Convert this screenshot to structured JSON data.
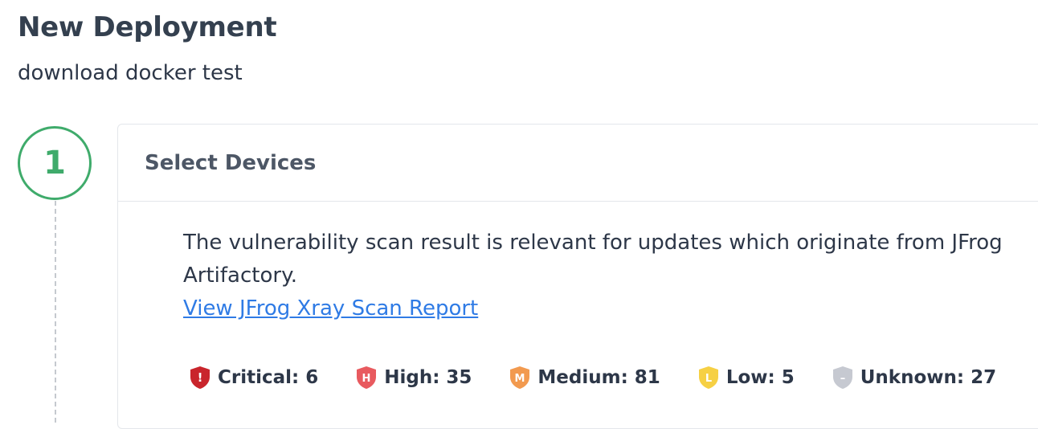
{
  "header": {
    "title": "New Deployment",
    "subtitle": "download docker test"
  },
  "step": {
    "number": "1",
    "color": "#3fab6b",
    "title": "Select Devices"
  },
  "scan": {
    "message": "The vulnerability scan result is relevant for updates which originate from JFrog Artifactory.",
    "link_label": "View JFrog Xray Scan Report",
    "link_color": "#2f7be5"
  },
  "severities": [
    {
      "icon": "critical-shield-icon",
      "letter": "!",
      "label": "Critical: 6",
      "color": "#c9252c"
    },
    {
      "icon": "high-shield-icon",
      "letter": "H",
      "label": "High: 35",
      "color": "#e85a5f"
    },
    {
      "icon": "medium-shield-icon",
      "letter": "M",
      "label": "Medium: 81",
      "color": "#f29a4f"
    },
    {
      "icon": "low-shield-icon",
      "letter": "L",
      "label": "Low: 5",
      "color": "#f6d044"
    },
    {
      "icon": "unknown-shield-icon",
      "letter": "–",
      "label": "Unknown: 27",
      "color": "#c6c9d1"
    }
  ]
}
